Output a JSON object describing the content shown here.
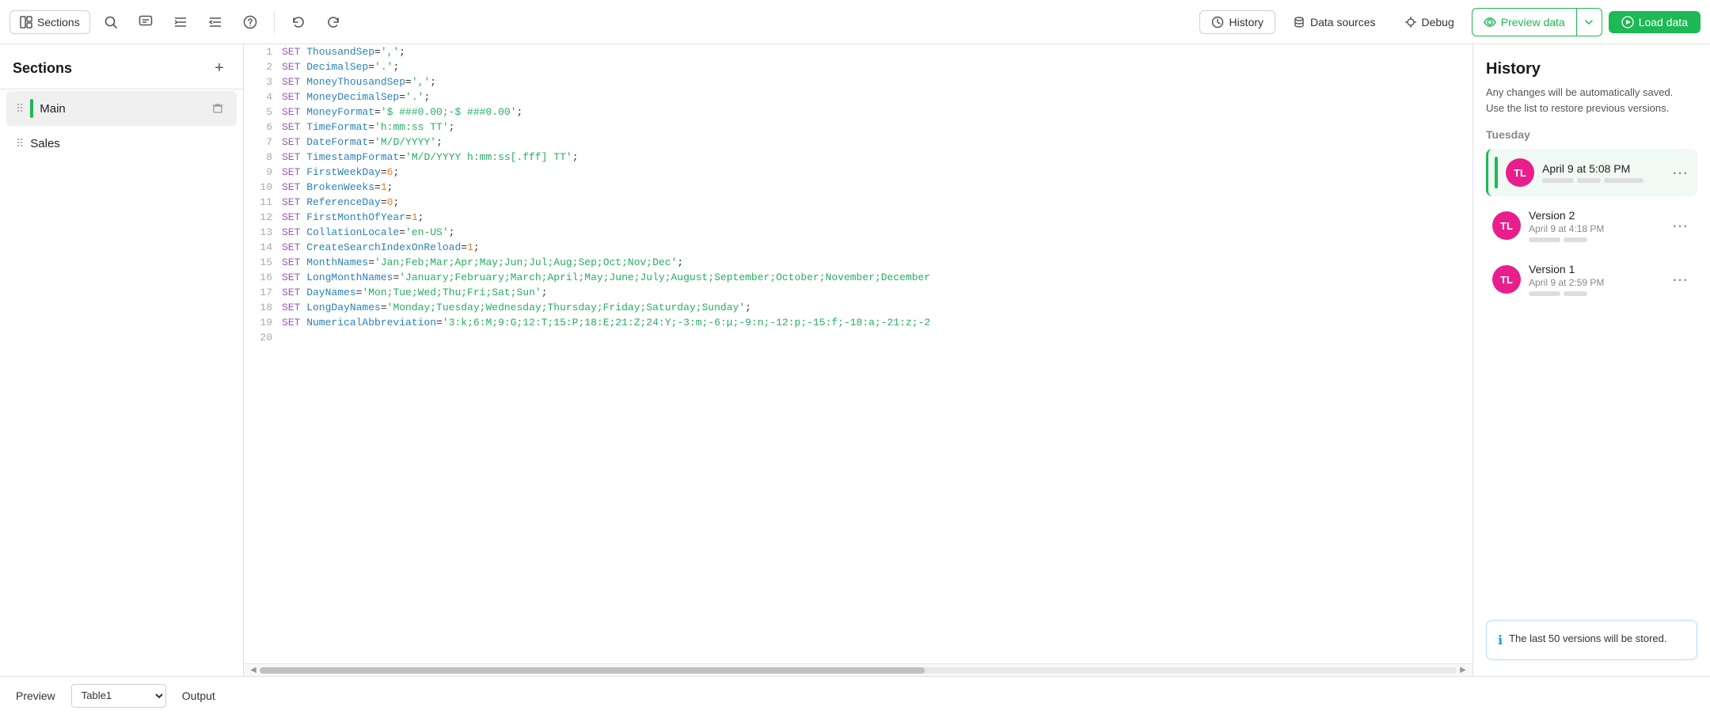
{
  "toolbar": {
    "sections_label": "Sections",
    "history_label": "History",
    "datasources_label": "Data sources",
    "debug_label": "Debug",
    "preview_label": "Preview data",
    "load_label": "Load data"
  },
  "sidebar": {
    "title": "Sections",
    "items": [
      {
        "id": "main",
        "label": "Main",
        "active": true
      },
      {
        "id": "sales",
        "label": "Sales",
        "active": false
      }
    ]
  },
  "editor": {
    "lines": [
      {
        "num": 1,
        "code": "SET ThousandSep=',';",
        "parts": [
          {
            "t": "kw",
            "v": "SET"
          },
          {
            "t": "prop",
            "v": " ThousandSep"
          },
          {
            "t": "op",
            "v": "="
          },
          {
            "t": "str",
            "v": "','"
          },
          {
            "t": "op",
            "v": ";"
          }
        ]
      },
      {
        "num": 2,
        "code": "SET DecimalSep='.';",
        "parts": [
          {
            "t": "kw",
            "v": "SET"
          },
          {
            "t": "prop",
            "v": " DecimalSep"
          },
          {
            "t": "op",
            "v": "="
          },
          {
            "t": "str",
            "v": "'.'"
          },
          {
            "t": "op",
            "v": ";"
          }
        ]
      },
      {
        "num": 3,
        "code": "SET MoneyThousandSep=',';",
        "parts": [
          {
            "t": "kw",
            "v": "SET"
          },
          {
            "t": "prop",
            "v": " MoneyThousandSep"
          },
          {
            "t": "op",
            "v": "="
          },
          {
            "t": "str",
            "v": "','"
          },
          {
            "t": "op",
            "v": ";"
          }
        ]
      },
      {
        "num": 4,
        "code": "SET MoneyDecimalSep='.';",
        "parts": [
          {
            "t": "kw",
            "v": "SET"
          },
          {
            "t": "prop",
            "v": " MoneyDecimalSep"
          },
          {
            "t": "op",
            "v": "="
          },
          {
            "t": "str",
            "v": "'.'"
          },
          {
            "t": "op",
            "v": ";"
          }
        ]
      },
      {
        "num": 5,
        "code": "SET MoneyFormat='$ ###0.00;-$ ###0.00';",
        "parts": [
          {
            "t": "kw",
            "v": "SET"
          },
          {
            "t": "prop",
            "v": " MoneyFormat"
          },
          {
            "t": "op",
            "v": "="
          },
          {
            "t": "str",
            "v": "'$ ###0.00;-$ ###0.00'"
          },
          {
            "t": "op",
            "v": ";"
          }
        ]
      },
      {
        "num": 6,
        "code": "SET TimeFormat='h:mm:ss TT';",
        "parts": [
          {
            "t": "kw",
            "v": "SET"
          },
          {
            "t": "prop",
            "v": " TimeFormat"
          },
          {
            "t": "op",
            "v": "="
          },
          {
            "t": "str",
            "v": "'h:mm:ss TT'"
          },
          {
            "t": "op",
            "v": ";"
          }
        ]
      },
      {
        "num": 7,
        "code": "SET DateFormat='M/D/YYYY';",
        "parts": [
          {
            "t": "kw",
            "v": "SET"
          },
          {
            "t": "prop",
            "v": " DateFormat"
          },
          {
            "t": "op",
            "v": "="
          },
          {
            "t": "str",
            "v": "'M/D/YYYY'"
          },
          {
            "t": "op",
            "v": ";"
          }
        ]
      },
      {
        "num": 8,
        "code": "SET TimestampFormat='M/D/YYYY h:mm:ss[.fff] TT';",
        "parts": [
          {
            "t": "kw",
            "v": "SET"
          },
          {
            "t": "prop",
            "v": " TimestampFormat"
          },
          {
            "t": "op",
            "v": "="
          },
          {
            "t": "str",
            "v": "'M/D/YYYY h:mm:ss[.fff] TT'"
          },
          {
            "t": "op",
            "v": ";"
          }
        ]
      },
      {
        "num": 9,
        "code": "SET FirstWeekDay=6;",
        "parts": [
          {
            "t": "kw",
            "v": "SET"
          },
          {
            "t": "prop",
            "v": " FirstWeekDay"
          },
          {
            "t": "op",
            "v": "="
          },
          {
            "t": "val",
            "v": "6"
          },
          {
            "t": "op",
            "v": ";"
          }
        ]
      },
      {
        "num": 10,
        "code": "SET BrokenWeeks=1;",
        "parts": [
          {
            "t": "kw",
            "v": "SET"
          },
          {
            "t": "prop",
            "v": " BrokenWeeks"
          },
          {
            "t": "op",
            "v": "="
          },
          {
            "t": "val",
            "v": "1"
          },
          {
            "t": "op",
            "v": ";"
          }
        ]
      },
      {
        "num": 11,
        "code": "SET ReferenceDay=0;",
        "parts": [
          {
            "t": "kw",
            "v": "SET"
          },
          {
            "t": "prop",
            "v": " ReferenceDay"
          },
          {
            "t": "op",
            "v": "="
          },
          {
            "t": "val",
            "v": "0"
          },
          {
            "t": "op",
            "v": ";"
          }
        ]
      },
      {
        "num": 12,
        "code": "SET FirstMonthOfYear=1;",
        "parts": [
          {
            "t": "kw",
            "v": "SET"
          },
          {
            "t": "prop",
            "v": " FirstMonthOfYear"
          },
          {
            "t": "op",
            "v": "="
          },
          {
            "t": "val",
            "v": "1"
          },
          {
            "t": "op",
            "v": ";"
          }
        ]
      },
      {
        "num": 13,
        "code": "SET CollationLocale='en-US';",
        "parts": [
          {
            "t": "kw",
            "v": "SET"
          },
          {
            "t": "prop",
            "v": " CollationLocale"
          },
          {
            "t": "op",
            "v": "="
          },
          {
            "t": "str",
            "v": "'en-US'"
          },
          {
            "t": "op",
            "v": ";"
          }
        ]
      },
      {
        "num": 14,
        "code": "SET CreateSearchIndexOnReload=1;",
        "parts": [
          {
            "t": "kw",
            "v": "SET"
          },
          {
            "t": "prop",
            "v": " CreateSearchIndexOnReload"
          },
          {
            "t": "op",
            "v": "="
          },
          {
            "t": "val",
            "v": "1"
          },
          {
            "t": "op",
            "v": ";"
          }
        ]
      },
      {
        "num": 15,
        "code": "SET MonthNames='Jan;Feb;Mar;Apr;May;Jun;Jul;Aug;Sep;Oct;Nov;Dec';",
        "parts": [
          {
            "t": "kw",
            "v": "SET"
          },
          {
            "t": "prop",
            "v": " MonthNames"
          },
          {
            "t": "op",
            "v": "="
          },
          {
            "t": "str",
            "v": "'Jan;Feb;Mar;Apr;May;Jun;Jul;Aug;Sep;Oct;Nov;Dec'"
          },
          {
            "t": "op",
            "v": ";"
          }
        ]
      },
      {
        "num": 16,
        "code": "SET LongMonthNames='January;February;March;April;May;June;July;August;September;October;November;December",
        "parts": [
          {
            "t": "kw",
            "v": "SET"
          },
          {
            "t": "prop",
            "v": " LongMonthNames"
          },
          {
            "t": "op",
            "v": "="
          },
          {
            "t": "str",
            "v": "'January;February;March;April;May;June;July;August;September;October;November;December"
          }
        ]
      },
      {
        "num": 17,
        "code": "SET DayNames='Mon;Tue;Wed;Thu;Fri;Sat;Sun';",
        "parts": [
          {
            "t": "kw",
            "v": "SET"
          },
          {
            "t": "prop",
            "v": " DayNames"
          },
          {
            "t": "op",
            "v": "="
          },
          {
            "t": "str",
            "v": "'Mon;Tue;Wed;Thu;Fri;Sat;Sun'"
          },
          {
            "t": "op",
            "v": ";"
          }
        ]
      },
      {
        "num": 18,
        "code": "SET LongDayNames='Monday;Tuesday;Wednesday;Thursday;Friday;Saturday;Sunday';",
        "parts": [
          {
            "t": "kw",
            "v": "SET"
          },
          {
            "t": "prop",
            "v": " LongDayNames"
          },
          {
            "t": "op",
            "v": "="
          },
          {
            "t": "str",
            "v": "'Monday;Tuesday;Wednesday;Thursday;Friday;Saturday;Sunday'"
          },
          {
            "t": "op",
            "v": ";"
          }
        ]
      },
      {
        "num": 19,
        "code": "SET NumericalAbbreviation='3:k;6:M;9:G;12:T;15:P;18:E;21:Z;24:Y;-3:m;-6:μ;-9:n;-12:p;-15:f;-18:a;-21:z;-2",
        "parts": [
          {
            "t": "kw",
            "v": "SET"
          },
          {
            "t": "prop",
            "v": " NumericalAbbreviation"
          },
          {
            "t": "op",
            "v": "="
          },
          {
            "t": "str",
            "v": "'3:k;6:M;9:G;12:T;15:P;18:E;21:Z;24:Y;-3:m;-6:μ;-9:n;-12:p;-15:f;-18:a;-21:z;-2"
          }
        ]
      },
      {
        "num": 20,
        "code": "",
        "parts": []
      }
    ]
  },
  "history": {
    "title": "History",
    "description_line1": "Any changes will be automatically saved.",
    "description_line2": "Use the list to restore previous versions.",
    "day_label": "Tuesday",
    "versions": [
      {
        "id": "current",
        "label": "April 9 at 5:08 PM",
        "version_name": "",
        "avatar_initials": "TL",
        "active": true,
        "preview_blocks": [
          40,
          30,
          50
        ]
      },
      {
        "id": "v2",
        "label": "April 9 at 4:18 PM",
        "version_name": "Version 2",
        "avatar_initials": "TL",
        "active": false,
        "preview_blocks": [
          40,
          30
        ]
      },
      {
        "id": "v1",
        "label": "April 9 at 2:59 PM",
        "version_name": "Version 1",
        "avatar_initials": "TL",
        "active": false,
        "preview_blocks": [
          40,
          30
        ]
      }
    ],
    "notice": "The last 50 versions will be stored."
  },
  "bottom": {
    "preview_label": "Preview",
    "table_placeholder": "Table1",
    "output_label": "Output"
  }
}
